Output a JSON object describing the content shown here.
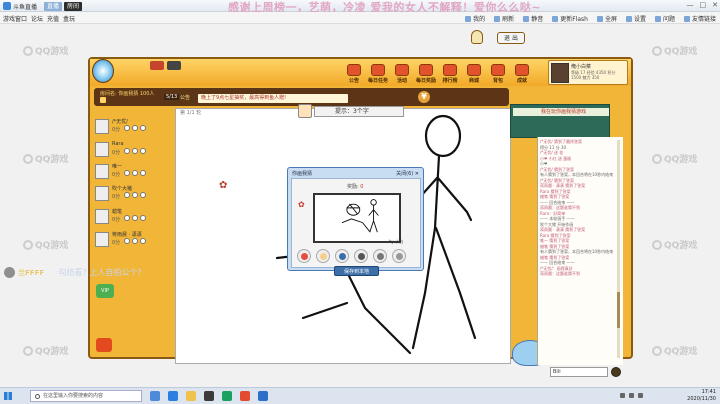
{
  "window": {
    "app_name": "斗鱼直播",
    "title_tags": [
      "直播",
      "房间"
    ],
    "banner": "感谢上周榜一，艺萌，冷凌 爱我的女人不解释！爱你么么哒~",
    "controls": [
      "—",
      "□",
      "✕"
    ]
  },
  "menubar": {
    "left": [
      "游戏窗口",
      "论坛",
      "充值",
      "盒玩"
    ],
    "right": [
      "我的",
      "刷新",
      "静音",
      "更新Flash",
      "全屏",
      "设置",
      "问题",
      "友情链接"
    ]
  },
  "watermark": "QQ游戏",
  "game": {
    "nav": [
      "公告",
      "每日任务",
      "活动",
      "每日奖励",
      "排行榜",
      "商城",
      "背包",
      "成就"
    ],
    "user_name": "俺小白菜",
    "user_stats": "等级 17 经验 4350 积分 1500 魅力 350",
    "room_info": "房间名: 你画我猜 100人",
    "round": "5/13",
    "notice_label": "公告",
    "reward_text": "晚上了9点七星抽奖，最高得到鱼人赠!",
    "exit_label": "退 出",
    "players": [
      {
        "name": "/*无忧/",
        "score": "0分"
      },
      {
        "name": "Rara",
        "score": "0分"
      },
      {
        "name": "唯一",
        "score": "0分"
      },
      {
        "name": "吹个大猪",
        "score": "0分"
      },
      {
        "name": "蜡笔",
        "score": "0分"
      },
      {
        "name": "蒋雨晨 · 潇潇",
        "score": "0分"
      }
    ],
    "vip_label": "VIP",
    "canvas_header": "第 1/1 轮",
    "hint_label": "提示：3个字",
    "popup": {
      "title": "你画我猜",
      "close": "关闭(6)  ✕",
      "score_label": "奖励:",
      "score_value": "0",
      "thumb_author": "by 小白",
      "save_label": "保存到本地"
    },
    "chat_head": "我在玩你画我猜游戏",
    "chat_lines": [
      {
        "cls": "pk",
        "text": "/*无忧/ 猜到了最终答案"
      },
      {
        "cls": "sys",
        "text": "得分 11 分 30"
      },
      {
        "cls": "pk",
        "text": "/*无忧/ 送 花"
      },
      {
        "cls": "pk",
        "text": "小❤ 小红 送 蛋糕"
      },
      {
        "cls": "sys",
        "text": "小❤"
      },
      {
        "cls": "pk",
        "text": "/*无忧/ 猜到了答案"
      },
      {
        "cls": "sys",
        "text": "有人猜到了答案，本回合将在10秒内结束"
      },
      {
        "cls": "pk",
        "text": "/*无忧/ 猜到了答案"
      },
      {
        "cls": "pk",
        "text": "蒋雨晨 · 潇潇 猜到了答案"
      },
      {
        "cls": "pk",
        "text": "Rara 猜到了答案"
      },
      {
        "cls": "pk",
        "text": "蜡笔 猜到了答案"
      },
      {
        "cls": "sys",
        "text": "—— 回合结束 ——"
      },
      {
        "cls": "pk",
        "text": "蒋雨晨：这题谁猜不到"
      },
      {
        "cls": "pk",
        "text": "Rara：好简单"
      },
      {
        "cls": "sys",
        "text": "—— 本轮画手 ——"
      },
      {
        "cls": "sys",
        "text": "吹个大猪 开始作画"
      },
      {
        "cls": "pk",
        "text": "蒋雨晨 · 潇潇 猜到了答案"
      },
      {
        "cls": "pk",
        "text": "Rara 猜到了答案"
      },
      {
        "cls": "pk",
        "text": "唯一 猜到了答案"
      },
      {
        "cls": "pk",
        "text": "蜡笔 猜到了答案"
      },
      {
        "cls": "sys",
        "text": "有人猜到了答案，本回合将在10秒内结束"
      },
      {
        "cls": "pk",
        "text": "蜡笔 猜到了答案"
      },
      {
        "cls": "sys",
        "text": "—— 回合结束 ——"
      },
      {
        "cls": "pk",
        "text": "/*无忧/：画得真好"
      },
      {
        "cls": "pk",
        "text": "蒋雨晨：这题谁猜不到"
      }
    ],
    "chat_input": "Bili"
  },
  "left_chat": {
    "name": "兰FFFF",
    "message": "·勾结看? 上人自拍公个?"
  },
  "taskbar": {
    "search_placeholder": "在这里输入你要搜索的内容",
    "time": "17:41",
    "date": "2020/11/30"
  }
}
